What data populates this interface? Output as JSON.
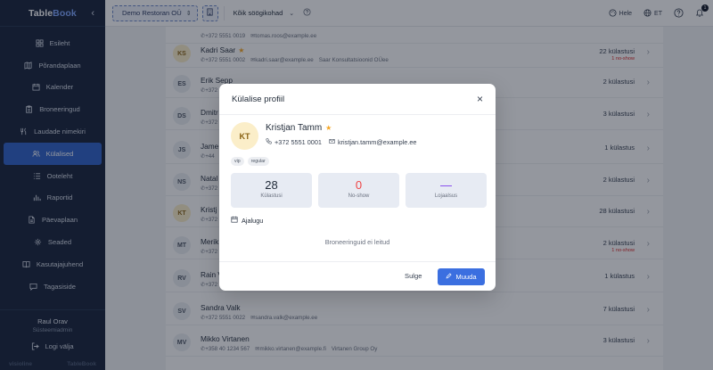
{
  "brand": {
    "name_part1": "Table",
    "name_part2": "Book",
    "collapse_icon": "chevron-left-icon"
  },
  "nav": [
    {
      "label": "Esileht",
      "icon": "dashboard-icon"
    },
    {
      "label": "Põrandaplaan",
      "icon": "floorplan-icon"
    },
    {
      "label": "Kalender",
      "icon": "calendar-icon"
    },
    {
      "label": "Broneeringud",
      "icon": "clipboard-icon"
    },
    {
      "label": "Laudade nimekiri",
      "icon": "utensils-icon"
    },
    {
      "label": "Külalised",
      "icon": "users-icon",
      "active": true
    },
    {
      "label": "Ooteleht",
      "icon": "list-icon"
    },
    {
      "label": "Raportid",
      "icon": "chart-icon"
    },
    {
      "label": "Päevaplaan",
      "icon": "document-icon"
    },
    {
      "label": "Seaded",
      "icon": "gear-icon"
    },
    {
      "label": "Kasutajajuhend",
      "icon": "book-icon"
    },
    {
      "label": "Tagasiside",
      "icon": "message-icon"
    }
  ],
  "user": {
    "name": "Raul Orav",
    "role": "Süsteemiadmin",
    "logout": "Logi välja"
  },
  "footer": {
    "left": "visioline",
    "right": "TableBook"
  },
  "topbar": {
    "restaurant": "Demo Restoran OÜ",
    "location": "Kõik söögikohad",
    "help_label": "Hele",
    "language": "ET",
    "notification_count": "1"
  },
  "guests": [
    {
      "initials": "",
      "name": "",
      "phone": "+372 5551 0019",
      "email": "tomas.roos@example.ee",
      "company": "",
      "count": "",
      "noshow": "",
      "vip": false
    },
    {
      "initials": "KS",
      "name": "Kadri Saar",
      "phone": "+372 5551 0002",
      "email": "kadri.saar@example.ee",
      "company": "Saar Konsultatsioonid OÜee",
      "count": "22 külastusi",
      "noshow": "1 no-show",
      "vip": true
    },
    {
      "initials": "ES",
      "name": "Erik Sepp",
      "phone": "+372 5",
      "email": "",
      "company": "",
      "count": "2 külastusi",
      "noshow": "",
      "vip": false
    },
    {
      "initials": "DS",
      "name": "Dmitr",
      "phone": "+372",
      "email": "",
      "company": "",
      "count": "3 külastusi",
      "noshow": "",
      "vip": false
    },
    {
      "initials": "JS",
      "name": "Jame",
      "phone": "+44",
      "email": "",
      "company": "",
      "count": "1 külastus",
      "noshow": "",
      "vip": false
    },
    {
      "initials": "NS",
      "name": "Natal",
      "phone": "+372",
      "email": "",
      "company": "",
      "count": "2 külastusi",
      "noshow": "",
      "vip": false
    },
    {
      "initials": "KT",
      "name": "Kristj",
      "phone": "+372",
      "email": "",
      "company": "",
      "count": "28 külastusi",
      "noshow": "",
      "vip": true
    },
    {
      "initials": "MT",
      "name": "Merik",
      "phone": "+372",
      "email": "",
      "company": "",
      "count": "2 külastusi",
      "noshow": "1 no-show",
      "vip": false
    },
    {
      "initials": "RV",
      "name": "Rain V",
      "phone": "+372",
      "email": "",
      "company": "",
      "count": "1 külastus",
      "noshow": "",
      "vip": false
    },
    {
      "initials": "SV",
      "name": "Sandra Valk",
      "phone": "+372 5551 0022",
      "email": "sandra.valk@example.ee",
      "company": "",
      "count": "7 külastusi",
      "noshow": "",
      "vip": false
    },
    {
      "initials": "MV",
      "name": "Mikko Virtanen",
      "phone": "+358 40 1234 567",
      "email": "mikko.virtanen@example.fi",
      "company": "Virtanen Group Oy",
      "count": "3 külastusi",
      "noshow": "",
      "vip": false
    },
    {
      "initials": "",
      "name": "",
      "phone": "",
      "email": "",
      "company": "",
      "count": "",
      "noshow": "",
      "vip": false
    }
  ],
  "modal": {
    "title": "Külalise profiil",
    "initials": "KT",
    "name": "Kristjan Tamm",
    "phone": "+372 5551 0001",
    "email": "kristjan.tamm@example.ee",
    "tags": [
      "vip",
      "regular"
    ],
    "stats": [
      {
        "value": "28",
        "label": "Külastusi"
      },
      {
        "value": "0",
        "label": "No-show"
      },
      {
        "value": "—",
        "label": "Lojaalsus"
      }
    ],
    "history_title": "Ajalugu",
    "empty_text": "Broneeringuid ei leitud",
    "close_label": "Sulge",
    "edit_label": "Muuda"
  },
  "colors": {
    "sidebar": "#16223a",
    "accent": "#2f62c9",
    "primary_button": "#3b6fe0",
    "vip_star": "#f5a623",
    "noshow_red": "#ef4444"
  }
}
